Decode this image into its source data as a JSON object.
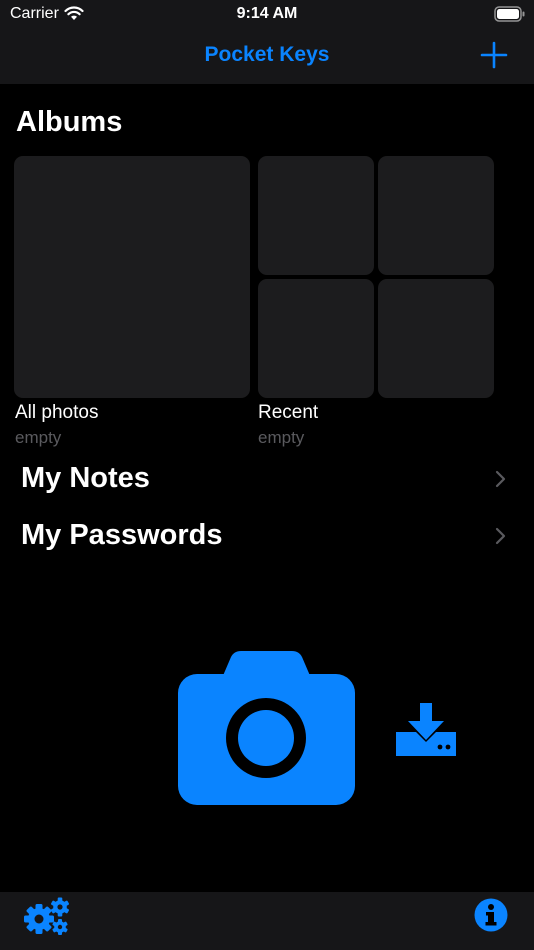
{
  "status_bar": {
    "carrier": "Carrier",
    "time": "9:14 AM"
  },
  "nav": {
    "title": "Pocket Keys",
    "add_icon": "plus-icon"
  },
  "albums": {
    "heading": "Albums",
    "items": [
      {
        "name": "All photos",
        "count": "empty"
      },
      {
        "name": "Recent",
        "count": "empty"
      }
    ]
  },
  "rows": [
    {
      "label": "My Notes"
    },
    {
      "label": "My Passwords"
    }
  ],
  "actions": {
    "camera_icon": "camera-icon",
    "import_icon": "download-icon"
  },
  "tabbar": {
    "left_icon": "gears-icon",
    "right_icon": "info-icon"
  },
  "colors": {
    "accent": "#0a84ff",
    "bar_background": "#161618",
    "tile": "#1c1c1e",
    "secondary_text": "#5a5a5e"
  }
}
